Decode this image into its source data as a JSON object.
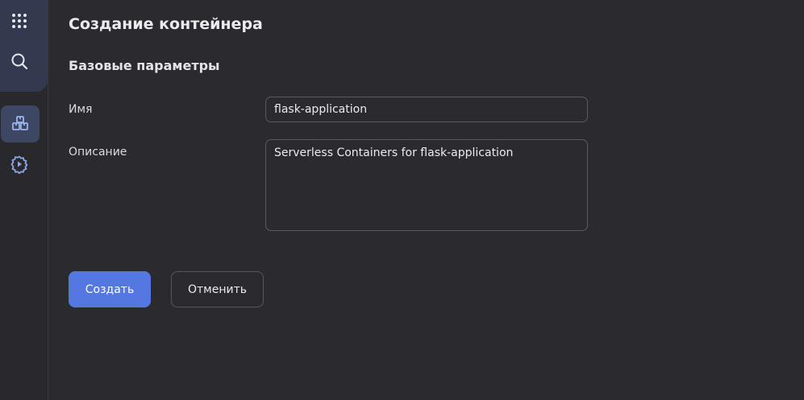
{
  "sidebar": {
    "items": [
      {
        "name": "grid-icon"
      },
      {
        "name": "search-icon"
      },
      {
        "name": "boxes-icon",
        "active": true
      },
      {
        "name": "gear-play-icon"
      }
    ]
  },
  "main": {
    "title": "Создание контейнера",
    "section_title": "Базовые параметры",
    "name_label": "Имя",
    "name_value": "flask-application",
    "description_label": "Описание",
    "description_value": "Serverless Containers for flask-application",
    "create_label": "Создать",
    "cancel_label": "Отменить"
  },
  "colors": {
    "background": "#2a2a2f",
    "sidebar_highlight": "#333a4f",
    "active_item": "#3d4763",
    "primary": "#5578e0",
    "border": "#5a5a62"
  }
}
